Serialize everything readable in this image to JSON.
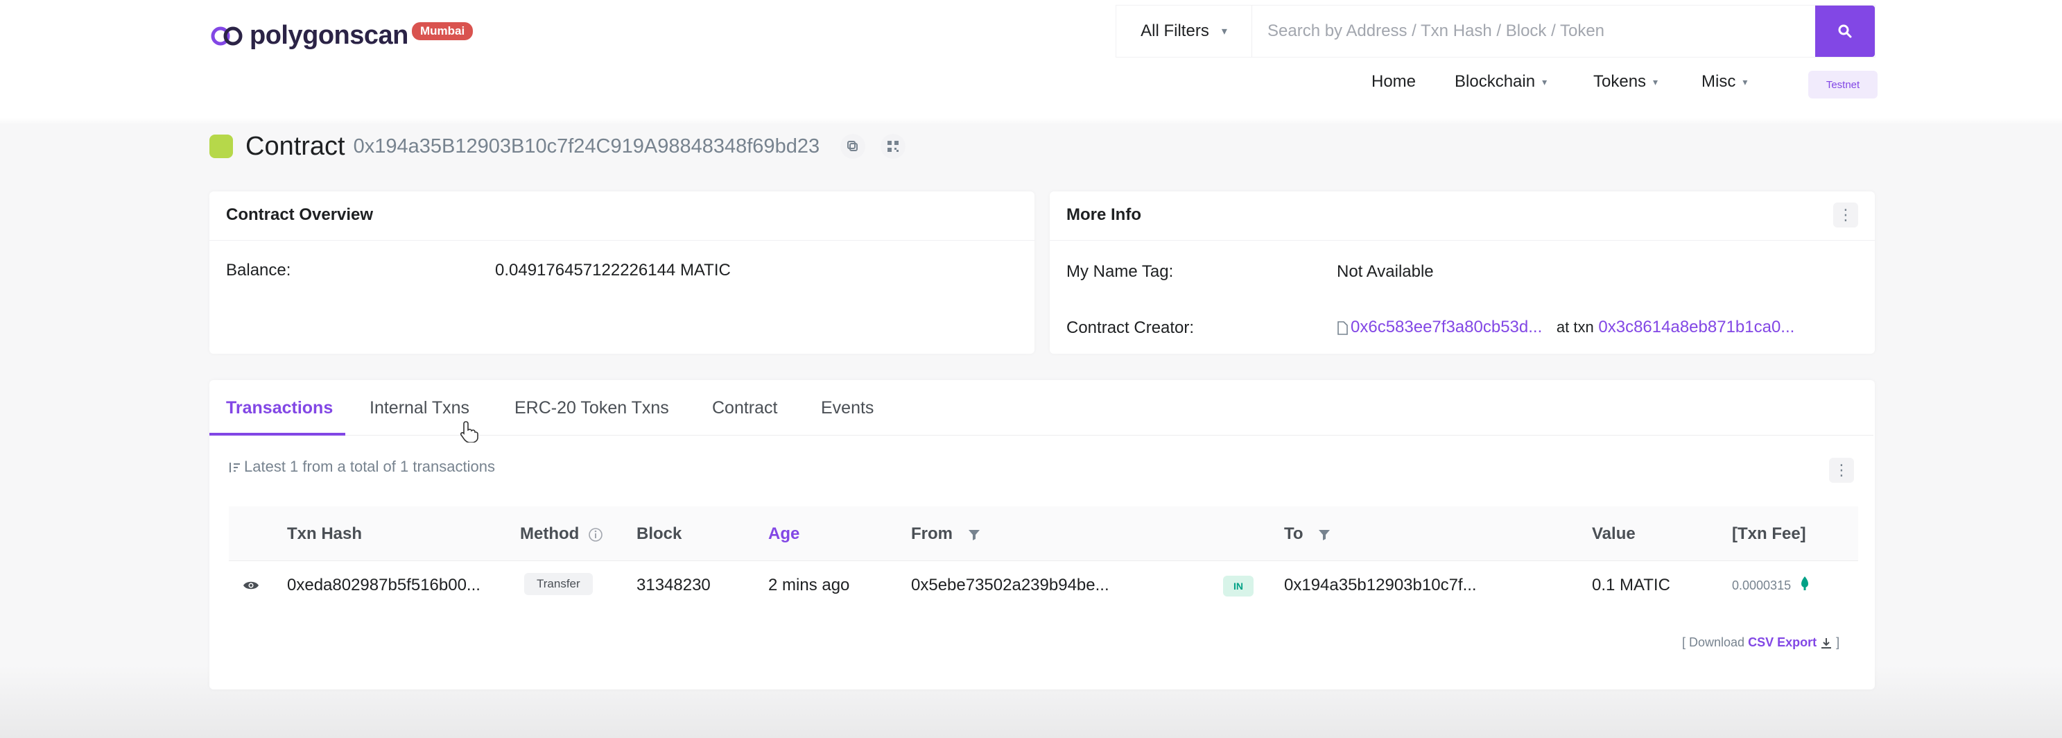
{
  "brand": {
    "name": "polygonscan",
    "network_badge": "Mumbai"
  },
  "search": {
    "filter_label": "All Filters",
    "placeholder": "Search by Address / Txn Hash / Block / Token"
  },
  "nav": {
    "home": "Home",
    "blockchain": "Blockchain",
    "tokens": "Tokens",
    "misc": "Misc",
    "testnet": "Testnet"
  },
  "page": {
    "title": "Contract",
    "address": "0x194a35B12903B10c7f24C919A98848348f69bd23"
  },
  "overview": {
    "title": "Contract Overview",
    "balance_label": "Balance:",
    "balance_value": "0.049176457122226144 MATIC"
  },
  "more_info": {
    "title": "More Info",
    "name_tag_label": "My Name Tag:",
    "name_tag_value": "Not Available",
    "creator_label": "Contract Creator:",
    "creator_address": "0x6c583ee7f3a80cb53d...",
    "at_txn": "at txn",
    "creator_txn": "0x3c8614a8eb871b1ca0..."
  },
  "tabs": [
    "Transactions",
    "Internal Txns",
    "ERC-20 Token Txns",
    "Contract",
    "Events"
  ],
  "summary": "Latest 1 from a total of 1 transactions",
  "table": {
    "headers": {
      "txn_hash": "Txn Hash",
      "method": "Method",
      "block": "Block",
      "age": "Age",
      "from": "From",
      "to": "To",
      "value": "Value",
      "fee": "[Txn Fee]"
    },
    "rows": [
      {
        "txn_hash": "0xeda802987b5f516b00...",
        "method": "Transfer",
        "block": "31348230",
        "age": "2 mins ago",
        "from": "0x5ebe73502a239b94be...",
        "direction": "IN",
        "to": "0x194a35b12903b10c7f...",
        "value": "0.1 MATIC",
        "fee": "0.0000315"
      }
    ]
  },
  "footer": {
    "prefix": "[ Download",
    "link": "CSV Export",
    "suffix": "]"
  },
  "colors": {
    "accent": "#8247e5",
    "badge": "#d9534f",
    "in_badge": "#00a186"
  }
}
